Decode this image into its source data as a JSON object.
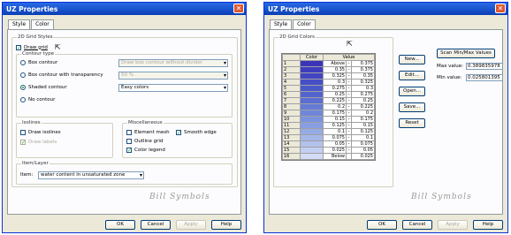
{
  "win1": {
    "title": "UZ Properties",
    "close": "✕",
    "tabs": [
      "Style",
      "Color"
    ],
    "grp_2d": "2D Grid Styles",
    "draw_grid": "Draw grid",
    "grp_contour": "Contour type",
    "box_contour": "Box contour",
    "box_contour_sel": "Draw box contour without divider",
    "box_transp": "Box contour with transparency",
    "box_transp_sel": "50 %",
    "shaded": "Shaded contour",
    "shaded_sel": "Easy colors",
    "no_contour": "No contour",
    "grp_iso": "Isolines",
    "draw_iso": "Draw isolines",
    "draw_labels": "Draw labels",
    "grp_misc": "Miscellaneous",
    "element_mesh": "Element mesh",
    "smooth_edge": "Smooth edge",
    "outline_grid": "Outline grid",
    "color_legend": "Color legend",
    "grp_item": "Item/Layer",
    "item_label": "Item:",
    "item_sel": "water content in unsaturated zone",
    "sig": "Bill Symbols",
    "buttons": {
      "ok": "OK",
      "cancel": "Cancel",
      "apply": "Apply",
      "help": "Help"
    }
  },
  "win2": {
    "title": "UZ Properties",
    "close": "✕",
    "tabs": [
      "Style",
      "Color"
    ],
    "grp_colors": "2D Grid Colors",
    "col_color": "Color",
    "col_value": "Value",
    "rows": [
      {
        "i": "1",
        "a": "Above",
        "s": "-",
        "b": "0.375",
        "c": "#3a34b8"
      },
      {
        "i": "2",
        "a": "0.35",
        "s": "-",
        "b": "0.375",
        "c": "#3d3cbe"
      },
      {
        "i": "3",
        "a": "0.325",
        "s": "-",
        "b": "0.35",
        "c": "#4145c2"
      },
      {
        "i": "4",
        "a": "0.3",
        "s": "-",
        "b": "0.325",
        "c": "#464ec6"
      },
      {
        "i": "5",
        "a": "0.275",
        "s": "-",
        "b": "0.3",
        "c": "#4b58ca"
      },
      {
        "i": "6",
        "a": "0.25",
        "s": "-",
        "b": "0.275",
        "c": "#5263ce"
      },
      {
        "i": "7",
        "a": "0.225",
        "s": "-",
        "b": "0.25",
        "c": "#5a6ed2"
      },
      {
        "i": "8",
        "a": "0.2",
        "s": "-",
        "b": "0.225",
        "c": "#647ad6"
      },
      {
        "i": "9",
        "a": "0.175",
        "s": "-",
        "b": "0.2",
        "c": "#6f86da"
      },
      {
        "i": "10",
        "a": "0.15",
        "s": "-",
        "b": "0.175",
        "c": "#7b92de"
      },
      {
        "i": "11",
        "a": "0.125",
        "s": "-",
        "b": "0.15",
        "c": "#889ee2"
      },
      {
        "i": "12",
        "a": "0.1",
        "s": "-",
        "b": "0.125",
        "c": "#96aae6"
      },
      {
        "i": "13",
        "a": "0.075",
        "s": "-",
        "b": "0.1",
        "c": "#a5b6ea"
      },
      {
        "i": "14",
        "a": "0.05",
        "s": "-",
        "b": "0.075",
        "c": "#b4c2ee"
      },
      {
        "i": "15",
        "a": "0.025",
        "s": "-",
        "b": "0.05",
        "c": "#c3cff2"
      },
      {
        "i": "16",
        "a": "Below",
        "s": "",
        "b": "0.025",
        "c": "#d3dcf6"
      }
    ],
    "new": "New...",
    "edit": "Edit...",
    "open": "Open...",
    "save": "Save...",
    "reset": "Reset",
    "scan": "Scan Min/Max Values",
    "max_label": "Max value:",
    "max_val": "0.389835978",
    "min_label": "Min value:",
    "min_val": "0.025801395",
    "sig": "Bill Symbols",
    "buttons": {
      "ok": "OK",
      "cancel": "Cancel",
      "apply": "Apply",
      "help": "Help"
    }
  }
}
